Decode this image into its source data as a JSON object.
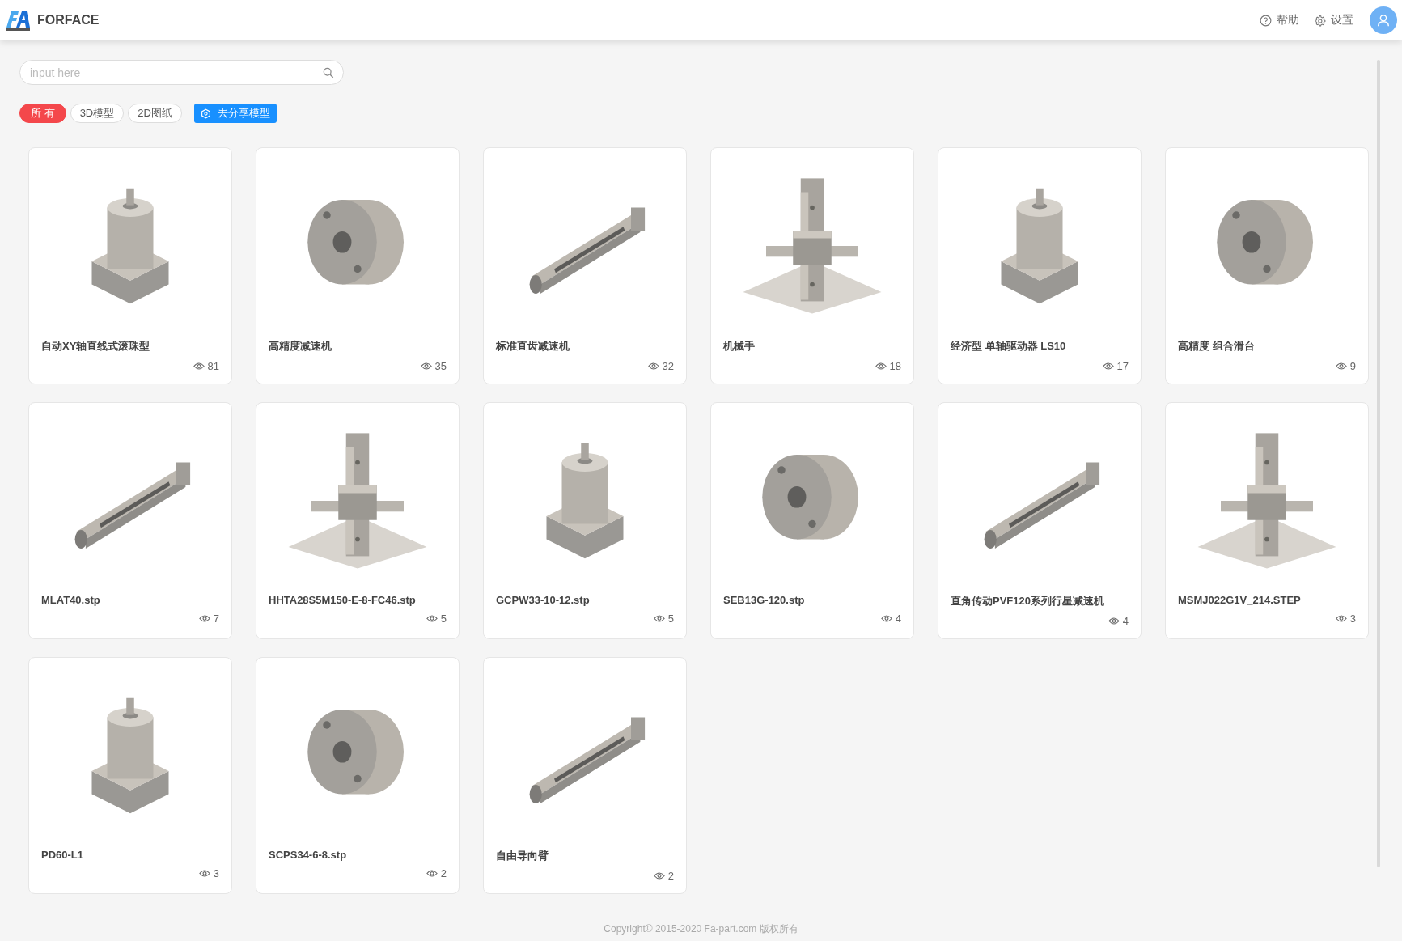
{
  "header": {
    "brand": "FORFACE",
    "links": [
      {
        "label": "帮助",
        "kind": "help"
      },
      {
        "label": "设置",
        "kind": "settings"
      }
    ]
  },
  "search": {
    "placeholder": "input here"
  },
  "filters": [
    {
      "label": "所 有",
      "selected": true
    },
    {
      "label": "3D模型",
      "selected": false
    },
    {
      "label": "2D图纸",
      "selected": false
    }
  ],
  "share_button": "去分享模型",
  "models": [
    {
      "title": "自动XY轴直线式滚珠型",
      "views": "81"
    },
    {
      "title": "高精度减速机",
      "views": "35"
    },
    {
      "title": "标准直齿减速机",
      "views": "32"
    },
    {
      "title": "机械手",
      "views": "18"
    },
    {
      "title": "经济型 单轴驱动器 LS10",
      "views": "17"
    },
    {
      "title": "高精度 组合滑台",
      "views": "9"
    },
    {
      "title": "MLAT40.stp",
      "views": "7"
    },
    {
      "title": "HHTA28S5M150-E-8-FC46.stp",
      "views": "5"
    },
    {
      "title": "GCPW33-10-12.stp",
      "views": "5"
    },
    {
      "title": "SEB13G-120.stp",
      "views": "4"
    },
    {
      "title": "直角传动PVF120系列行星减速机",
      "views": "4"
    },
    {
      "title": "MSMJ022G1V_214.STEP",
      "views": "3"
    },
    {
      "title": "PD60-L1",
      "views": "3"
    },
    {
      "title": "SCPS34-6-8.stp",
      "views": "2"
    },
    {
      "title": "自由导向臂",
      "views": "2"
    }
  ],
  "footer": "Copyright© 2015-2020 Fa-part.com 版权所有"
}
